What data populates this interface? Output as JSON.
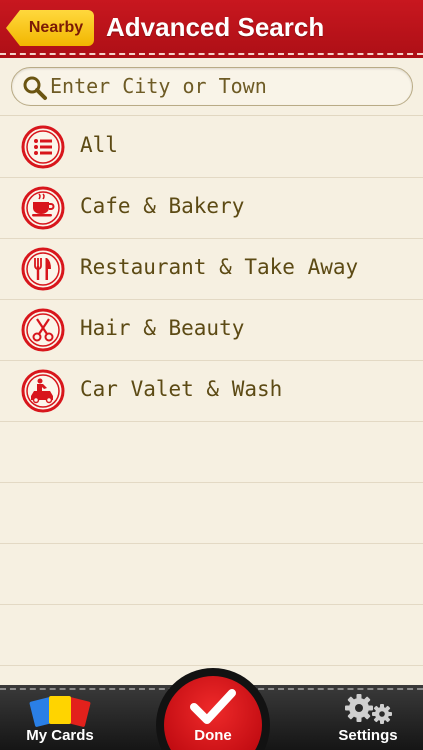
{
  "header": {
    "back_label": "Nearby",
    "title": "Advanced Search"
  },
  "search": {
    "placeholder": "Enter City or Town",
    "value": ""
  },
  "categories": [
    {
      "label": "All",
      "icon": "list-icon"
    },
    {
      "label": "Cafe & Bakery",
      "icon": "coffee-cup-icon"
    },
    {
      "label": "Restaurant & Take Away",
      "icon": "fork-knife-icon"
    },
    {
      "label": "Hair & Beauty",
      "icon": "scissors-icon"
    },
    {
      "label": "Car Valet & Wash",
      "icon": "car-wash-icon"
    }
  ],
  "tabbar": {
    "my_cards_label": "My Cards",
    "done_label": "Done",
    "settings_label": "Settings"
  },
  "colors": {
    "header_red": "#c8171f",
    "accent_red": "#d8161c",
    "back_yellow": "#ffd83d",
    "list_text": "#5c4a14",
    "background": "#f6f0e1"
  }
}
